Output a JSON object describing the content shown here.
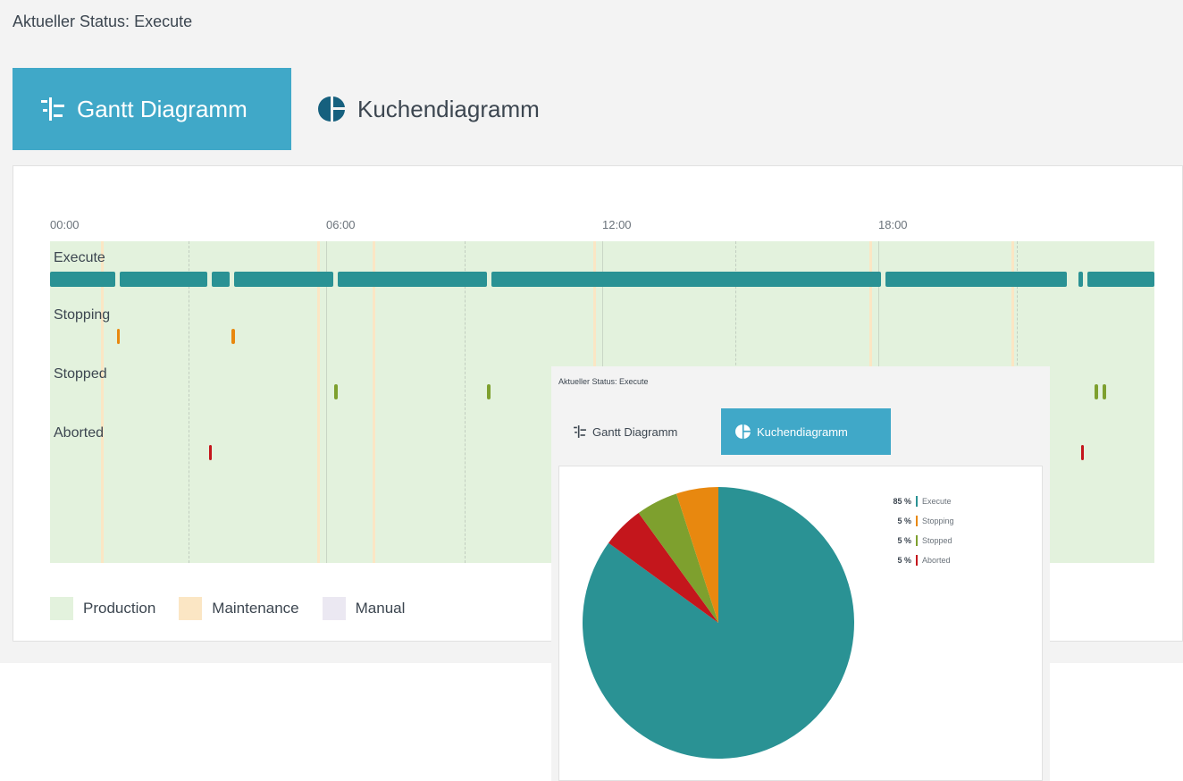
{
  "status_text": "Aktueller Status: Execute",
  "tabs": [
    {
      "label": "Gantt Diagramm",
      "icon": "gantt-icon",
      "active": true
    },
    {
      "label": "Kuchendiagramm",
      "icon": "pie-chart-icon",
      "active": false
    }
  ],
  "colors": {
    "accent": "#40a8c8",
    "execute": "#2a9294",
    "stopping": "#e8880f",
    "stopped": "#7ea02e",
    "aborted": "#c4161c",
    "production": "#e3f2dd",
    "maintenance": "#fbe6c4",
    "manual": "#ebe8f2"
  },
  "chart_data": [
    {
      "type": "gantt",
      "x_ticks": [
        "00:00",
        "06:00",
        "12:00",
        "18:00"
      ],
      "x_range_hours": [
        0,
        24
      ],
      "rows": [
        {
          "label": "Execute",
          "color": "#2a9294",
          "intervals": [
            [
              0.0,
              1.42
            ],
            [
              1.52,
              3.42
            ],
            [
              3.52,
              3.9
            ],
            [
              4.0,
              6.15
            ],
            [
              6.25,
              9.5
            ],
            [
              9.6,
              18.05
            ],
            [
              18.15,
              22.1
            ],
            [
              22.35,
              22.45
            ],
            [
              22.55,
              24.0
            ]
          ]
        },
        {
          "label": "Stopping",
          "color": "#e8880f",
          "intervals": [
            [
              1.45,
              1.52
            ],
            [
              3.95,
              4.02
            ]
          ]
        },
        {
          "label": "Stopped",
          "color": "#7ea02e",
          "intervals": [
            [
              6.18,
              6.25
            ],
            [
              9.5,
              9.57
            ],
            [
              22.7,
              22.77
            ],
            [
              22.88,
              22.95
            ]
          ]
        },
        {
          "label": "Aborted",
          "color": "#c4161c",
          "intervals": [
            [
              3.45,
              3.52
            ],
            [
              22.4,
              22.47
            ]
          ]
        }
      ],
      "legend": [
        {
          "label": "Production",
          "color": "#e3f2dd"
        },
        {
          "label": "Maintenance",
          "color": "#fbe6c4"
        },
        {
          "label": "Manual",
          "color": "#ebe8f2"
        }
      ]
    },
    {
      "type": "pie",
      "slices": [
        {
          "label": "Execute",
          "value": 85,
          "color": "#2a9294"
        },
        {
          "label": "Aborted",
          "value": 5,
          "color": "#c4161c"
        },
        {
          "label": "Stopped",
          "value": 5,
          "color": "#7ea02e"
        },
        {
          "label": "Stopping",
          "value": 5,
          "color": "#e8880f"
        }
      ]
    }
  ],
  "overlay": {
    "status_text": "Aktueller Status: Execute",
    "tabs": [
      {
        "label": "Gantt Diagramm",
        "icon": "gantt-icon",
        "active": false
      },
      {
        "label": "Kuchendiagramm",
        "icon": "pie-chart-icon",
        "active": true
      }
    ],
    "legend": [
      {
        "pct": "85 %",
        "label": "Execute",
        "color": "#2a9294"
      },
      {
        "pct": "5 %",
        "label": "Stopping",
        "color": "#e8880f"
      },
      {
        "pct": "5 %",
        "label": "Stopped",
        "color": "#7ea02e"
      },
      {
        "pct": "5 %",
        "label": "Aborted",
        "color": "#c4161c"
      }
    ]
  }
}
